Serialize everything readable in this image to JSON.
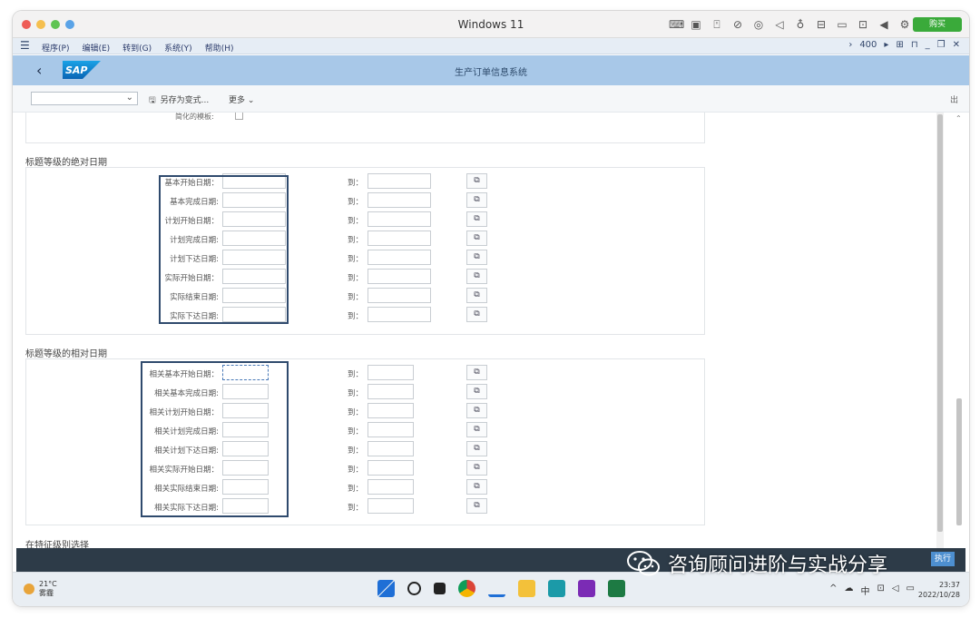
{
  "window": {
    "title": "Windows 11",
    "buy_label": "购买"
  },
  "menu": {
    "items": [
      "程序(P)",
      "编辑(E)",
      "转到(G)",
      "系统(Y)",
      "帮助(H)"
    ],
    "right_value": "400"
  },
  "header": {
    "title": "生产订单信息系统"
  },
  "toolbar": {
    "save_variant_label": "另存为变式...",
    "more_label": "更多",
    "exit_label": "出"
  },
  "top_partial_label": "简化的模板:",
  "abs_section": {
    "title": "标题等级的绝对日期",
    "to_label": "到：",
    "rows": [
      "基本开始日期：",
      "基本完成日期:",
      "计划开始日期：",
      "计划完成日期:",
      "计划下达日期:",
      "实际开始日期：",
      "实际结束日期:",
      "实际下达日期:"
    ]
  },
  "rel_section": {
    "title": "标题等级的相对日期",
    "to_label": "到：",
    "rows": [
      "相关基本开始日期：",
      "相关基本完成日期:",
      "相关计划开始日期：",
      "相关计划完成日期:",
      "相关计划下达日期:",
      "相关实际开始日期：",
      "相关实际结束日期:",
      "相关实际下达日期:"
    ]
  },
  "char_section": {
    "title": "在特征级别选择"
  },
  "execute_label": "执行",
  "taskbar": {
    "temp": "21°C",
    "weather": "雾霾",
    "time": "23:37",
    "date": "2022/10/28",
    "ime": "中"
  },
  "watermark": "咨询顾问进阶与实战分享",
  "colors": {
    "sap_header": "#a8c8e8",
    "highlight_box": "#2f4a6d",
    "dark_bar": "#2d3b48"
  }
}
